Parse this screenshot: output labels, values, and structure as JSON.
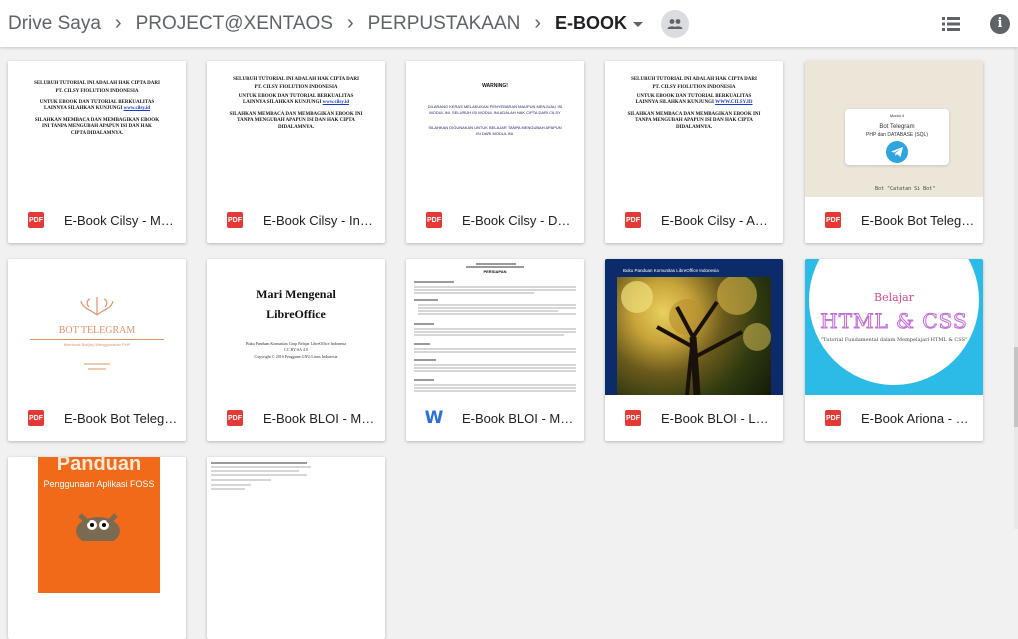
{
  "breadcrumbs": [
    "Drive Saya",
    "PROJECT@XENTAOS",
    "PERPUSTAKAAN",
    "E-BOOK"
  ],
  "header": {
    "list_icon": "list-view-icon",
    "info_icon": "info-icon",
    "share_icon": "shared-people-icon",
    "info_glyph": "i"
  },
  "files": [
    {
      "name": "E-Book Cilsy - Me…",
      "type": "pdf",
      "thumb": {
        "heading": "SELURUH TUTORIAL INI ADALAH HAK CIPTA DARI",
        "org": "PT. CILSY FIOLUTION INDONESIA",
        "line3": "UNTUK EBOOK DAN TUTORIAL BERKUALITAS LAINNYA SILAHKAN KUNJUNGI",
        "url": "www.cilsy.id",
        "note": "SILAHKAN MEMBACA DAN MEMBAGIKAN EBOOK INI TANPA MENGUBAH APAPUN ISI DAN HAK CIPTA DIDALAMNYA."
      }
    },
    {
      "name": "E-Book Cilsy - Inst…",
      "type": "pdf",
      "thumb": {
        "heading": "SELURUH TUTORIAL INI ADALAH HAK CIPTA DARI",
        "org": "PT. CILSY FIOLUTION INDONESIA",
        "line3": "UNTUK EBOOK DAN TUTORIAL BERKUALITAS LAINNYA SILAHKAN KUNJUNGI",
        "url": "www.cilsy.id",
        "note": "SILAHKAN MEMBACA DAN MEMBAGIKAN EBOOK INI TANPA MENGUBAH APAPUN ISI DAN HAK CIPTA DIDALAMNYA."
      }
    },
    {
      "name": "E-Book Cilsy - Da…",
      "type": "pdf",
      "thumb": {
        "heading": "WARNING!",
        "line2": "DILARANG KERAS MELAKUKAN PENYEBARAN MAUPUN MENJUALI ISI MODUL INI. SELURUH ISI MODUL INI ADALAH HAK CIPTA DARI CILSY",
        "line3": "SILAHKAN DIGUNAKAN UNTUK BELAJAR TANPA MENGUBAH APAPUN ISI DARI MODUL INI."
      }
    },
    {
      "name": "E-Book Cilsy - Ad…",
      "type": "pdf",
      "thumb": {
        "heading": "SELURUH TUTORIAL INI ADALAH HAK CIPTA DARI",
        "org": "PT. CILSY FIOLUTION INDONESIA",
        "line3": "UNTUK EBOOK DAN TUTORIAL BERKUALITAS LAINNYA SILAHKAN KUNJUNGI",
        "url": "WWW.CILSY.ID",
        "note": "SILAHKAN MEMBACA DAN MEMBAGIKAN EBOOK INI TANPA MENGUBAH APAPUN ISI DAN HAK CIPTA DIDALAMNYA."
      }
    },
    {
      "name": "E-Book Bot Telegr…",
      "type": "pdf",
      "thumb": {
        "small": "Modul 4",
        "title1": "Bot Telegram",
        "title2": "PHP dan DATABASE (SQL)",
        "code": "Bot \"Catatan Si Bot\""
      }
    },
    {
      "name": "E-Book Bot Telegr…",
      "type": "pdf",
      "thumb": {
        "title": "BOT TELEGRAM",
        "sub": "Membuat Bot(ku) Menggunakan PHP"
      }
    },
    {
      "name": "E-Book BLOI - Ma…",
      "type": "pdf",
      "thumb": {
        "title1": "Mari Mengenal",
        "title2": "LibreOffice",
        "l1": "Buku Panduan Komunitas Grup Belajar LibreOffice Indonesia",
        "l2": "CC BY-SA 4.0",
        "l3": "Copyright © 2016 Pengguna GNU/Linux Indonesia"
      }
    },
    {
      "name": "E-Book BLOI - Ma…",
      "type": "word",
      "thumb": {
        "heading": "PERSIAPAN"
      }
    },
    {
      "name": "E-Book BLOI - Leb…",
      "type": "pdf",
      "thumb": {
        "banner": "Buku Panduan Komunitas LibreOffice Indonesia"
      }
    },
    {
      "name": "E-Book Ariona - B…",
      "type": "pdf",
      "thumb": {
        "word1": "Belajar",
        "title": "HTML & CSS",
        "sub": "\"Tutorial Fundamental dalam Mempelajari HTML & CSS\""
      }
    },
    {
      "name": "",
      "type": "pdf",
      "thumb": {
        "t1": "Panduan",
        "t2": "Penggunaan Aplikasi FOSS"
      }
    },
    {
      "name": "",
      "type": "pdf",
      "thumb": {}
    }
  ]
}
